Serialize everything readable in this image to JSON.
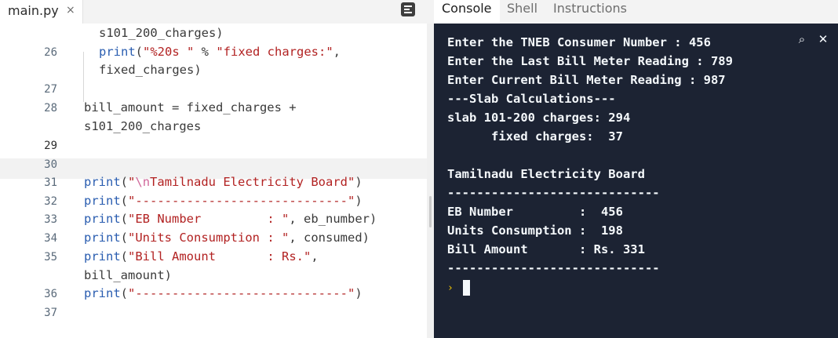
{
  "file_tab": {
    "name": "main.py",
    "close_glyph": "×"
  },
  "panel_tabs": [
    "Console",
    "Shell",
    "Instructions"
  ],
  "editor": {
    "line_numbers": [
      "26",
      "27",
      "28",
      "29",
      "30",
      "31",
      "32",
      "33",
      "34",
      "35",
      "36",
      "37"
    ],
    "current_line": "29",
    "lines": {
      "l25_tail": "s101_200_charges)",
      "l26_fn": "print",
      "l26_str": "\"%20s \"",
      "l26_rest": " % ",
      "l26_str2": "\"fixed charges:\"",
      "l26_tail": ",",
      "l26_cont": "fixed_charges)",
      "l28": "bill_amount = fixed_charges +",
      "l28_cont": "s101_200_charges",
      "l31_fn": "print",
      "l31_esc": "\\n",
      "l31_str": "Tamilnadu Electricity Board\"",
      "l31_q": "\"",
      "l32_fn": "print",
      "l32_str": "\"-----------------------------\"",
      "l33_fn": "print",
      "l33_str": "\"EB Number         : \"",
      "l33_rest": ", eb_number)",
      "l34_fn": "print",
      "l34_str": "\"Units Consumption : \"",
      "l34_rest": ", consumed)",
      "l35_fn": "print",
      "l35_str": "\"Bill Amount       : Rs.\"",
      "l35_rest": ",",
      "l35_cont": "bill_amount)",
      "l36_fn": "print",
      "l36_str": "\"-----------------------------\""
    }
  },
  "console": {
    "lines": [
      "Enter the TNEB Consumer Number : 456",
      "Enter the Last Bill Meter Reading : 789",
      "Enter Current Bill Meter Reading : 987",
      "---Slab Calculations---",
      "slab 101-200 charges: 294",
      "      fixed charges:  37",
      "",
      "Tamilnadu Electricity Board",
      "-----------------------------",
      "EB Number         :  456",
      "Units Consumption :  198",
      "Bill Amount       : Rs. 331",
      "-----------------------------"
    ],
    "prompt_glyph": "›",
    "search_glyph": "⌕",
    "close_glyph": "✕"
  }
}
